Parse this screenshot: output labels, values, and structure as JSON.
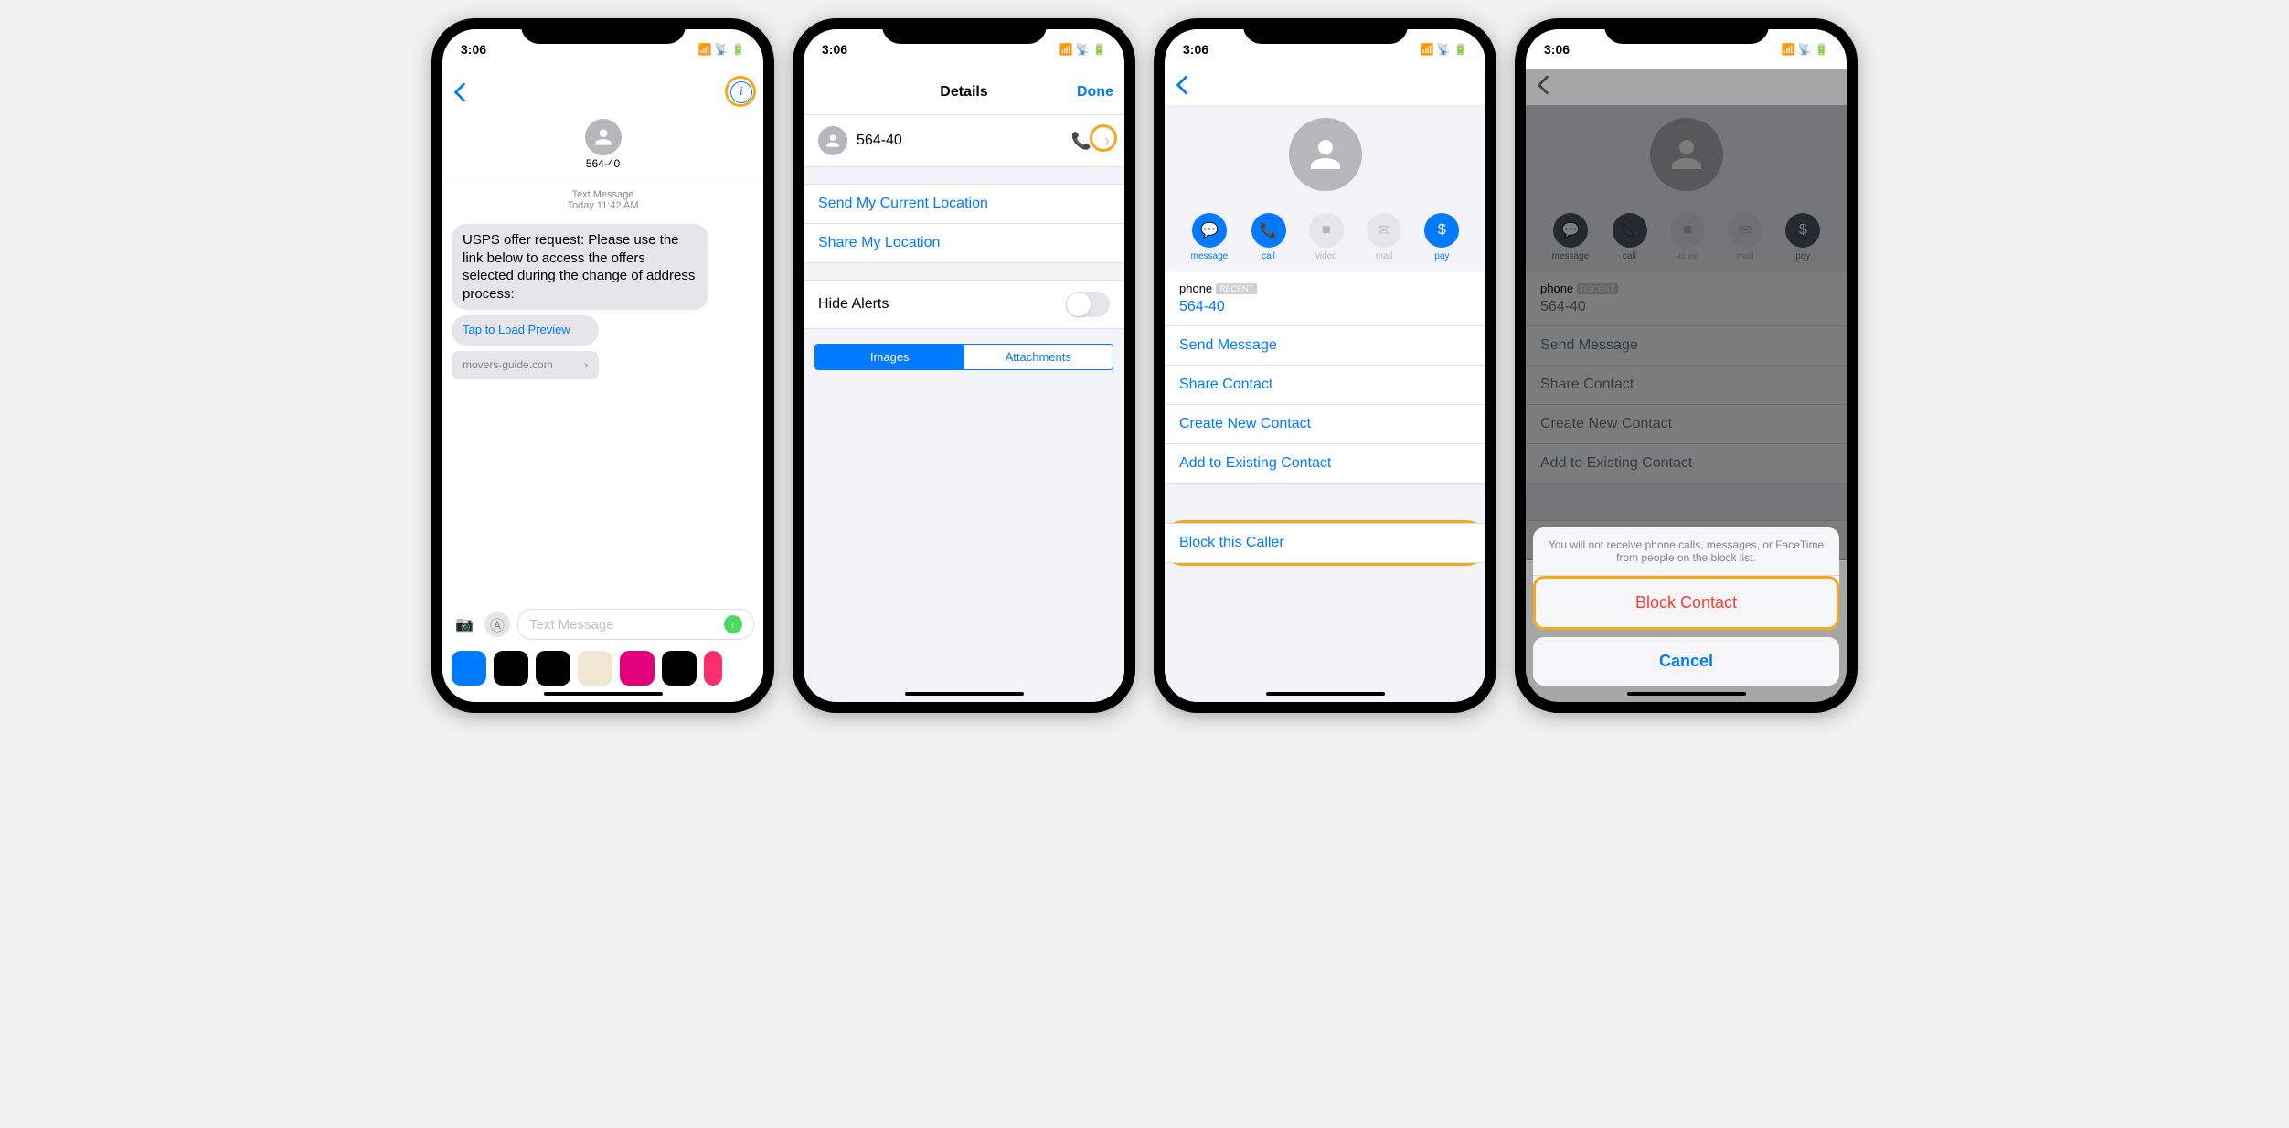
{
  "status": {
    "time": "3:06",
    "loc": "◀"
  },
  "s1": {
    "number": "564-40",
    "meta_type": "Text Message",
    "meta_time": "Today 11:42 AM",
    "message": "USPS offer request: Please use the link below to access the offers selected during the change of address process:",
    "load_preview": "Tap to Load Preview",
    "url": "movers-guide.com",
    "input_placeholder": "Text Message"
  },
  "s2": {
    "title": "Details",
    "done": "Done",
    "number": "564-40",
    "send_location": "Send My Current Location",
    "share_location": "Share My Location",
    "hide_alerts": "Hide Alerts",
    "seg_images": "Images",
    "seg_attachments": "Attachments"
  },
  "s3": {
    "phone_label": "phone",
    "badge": "RECENT",
    "number": "564-40",
    "actions": {
      "message": "message",
      "call": "call",
      "video": "video",
      "mail": "mail",
      "pay": "pay"
    },
    "links": {
      "send_message": "Send Message",
      "share_contact": "Share Contact",
      "create_contact": "Create New Contact",
      "add_existing": "Add to Existing Contact",
      "block": "Block this Caller"
    }
  },
  "s4": {
    "sheet_text": "You will not receive phone calls, messages, or FaceTime from people on the block list.",
    "block": "Block Contact",
    "cancel": "Cancel"
  }
}
